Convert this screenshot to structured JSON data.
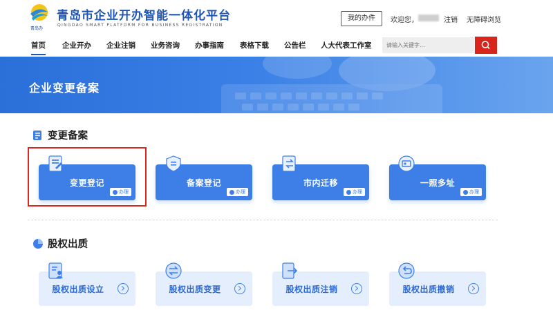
{
  "header": {
    "logo_text": "青岛办",
    "title": "青岛市企业开办智能一体化平台",
    "subtitle": "QINGDAO SMART PLATFORM FOR BUSINESS REGISTRATION",
    "my_tasks": "我的办件",
    "welcome": "欢迎您，",
    "logout": "注销",
    "accessible": "无障碍浏览"
  },
  "nav": {
    "items": [
      "首页",
      "企业开办",
      "企业注销",
      "业务咨询",
      "办事指南",
      "表格下载",
      "公告栏",
      "人大代表工作室"
    ],
    "active_index": 0,
    "search_placeholder": "请输入关键字..."
  },
  "banner": {
    "title": "企业变更备案"
  },
  "section1": {
    "title": "变更备案",
    "cards": [
      {
        "label": "变更登记",
        "tag": "办理",
        "icon": "document-edit-icon"
      },
      {
        "label": "备案登记",
        "tag": "办理",
        "icon": "shield-record-icon"
      },
      {
        "label": "市内迁移",
        "tag": "办理",
        "icon": "transfer-icon"
      },
      {
        "label": "一照多址",
        "tag": "办理",
        "icon": "license-icon"
      }
    ]
  },
  "section2": {
    "title": "股权出质",
    "cards": [
      {
        "label": "股权出质设立",
        "icon": "person-document-icon"
      },
      {
        "label": "股权出质变更",
        "icon": "exchange-icon"
      },
      {
        "label": "股权出质注销",
        "icon": "logout-document-icon"
      },
      {
        "label": "股权出质撤销",
        "icon": "undo-icon"
      }
    ]
  },
  "colors": {
    "primary": "#3d7fe6",
    "brand_title": "#1f56b5",
    "search_button": "#d9261c",
    "highlight": "#e0251e",
    "light_card": "#e4eefc"
  }
}
